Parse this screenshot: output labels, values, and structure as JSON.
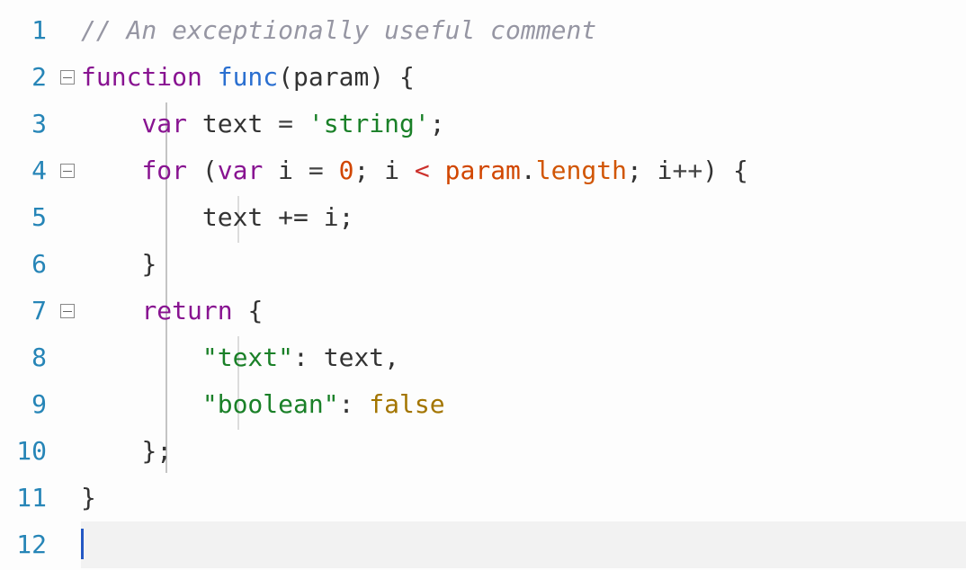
{
  "editor": {
    "line_count": 12,
    "current_line": 12,
    "line_numbers": [
      "1",
      "2",
      "3",
      "4",
      "5",
      "6",
      "7",
      "8",
      "9",
      "10",
      "11",
      "12"
    ],
    "fold_markers": {
      "2": "collapsible",
      "4": "collapsible",
      "7": "collapsible"
    }
  },
  "code": {
    "l1": {
      "comment": "// An exceptionally useful comment"
    },
    "l2": {
      "kw_function": "function",
      "sp1": " ",
      "fname": "func",
      "lp": "(",
      "param": "param",
      "rp": ")",
      "sp2": " ",
      "lb": "{"
    },
    "l3": {
      "indent": "    ",
      "kw_var": "var",
      "sp1": " ",
      "id_text": "text",
      "sp2": " ",
      "eq": "=",
      "sp3": " ",
      "str": "'string'",
      "semi": ";"
    },
    "l4": {
      "indent": "    ",
      "kw_for": "for",
      "sp1": " ",
      "lp": "(",
      "kw_var": "var",
      "sp2": " ",
      "id_i": "i",
      "sp3": " ",
      "eq": "=",
      "sp4": " ",
      "num0": "0",
      "semi1": ";",
      "sp5": " ",
      "id_i2": "i",
      "sp6": " ",
      "lt": "<",
      "sp7": " ",
      "id_param": "param",
      "dot": ".",
      "prop": "length",
      "semi2": ";",
      "sp8": " ",
      "id_i3": "i",
      "inc": "++",
      "rp": ")",
      "sp9": " ",
      "lb": "{"
    },
    "l5": {
      "indent": "        ",
      "id_text": "text",
      "sp1": " ",
      "pluseq": "+=",
      "sp2": " ",
      "id_i": "i",
      "semi": ";"
    },
    "l6": {
      "indent": "    ",
      "rb": "}"
    },
    "l7": {
      "indent": "    ",
      "kw_return": "return",
      "sp1": " ",
      "lb": "{"
    },
    "l8": {
      "indent": "        ",
      "key": "\"text\"",
      "colon": ":",
      "sp1": " ",
      "val": "text",
      "comma": ","
    },
    "l9": {
      "indent": "        ",
      "key": "\"boolean\"",
      "colon": ":",
      "sp1": " ",
      "val": "false"
    },
    "l10": {
      "indent": "    ",
      "rb": "}",
      "semi": ";"
    },
    "l11": {
      "rb": "}"
    },
    "l12": {
      "empty": ""
    }
  }
}
